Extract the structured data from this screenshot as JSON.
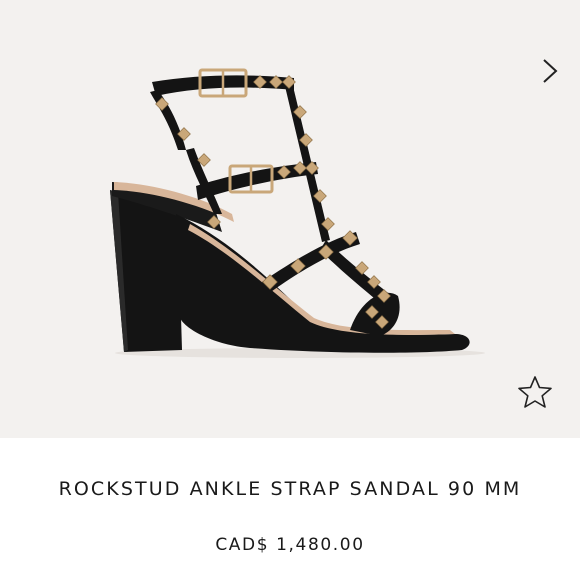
{
  "product": {
    "name": "ROCKSTUD ANKLE STRAP SANDAL 90 MM",
    "price": "CAD$ 1,480.00"
  },
  "icons": {
    "next": "chevron-right-icon",
    "wishlist": "star-outline-icon"
  },
  "colors": {
    "gallery_background": "#f3f1ef",
    "leather": "#141414",
    "studs": "#c9a779",
    "insole": "#d8b69a",
    "text": "#1a1a1a"
  }
}
